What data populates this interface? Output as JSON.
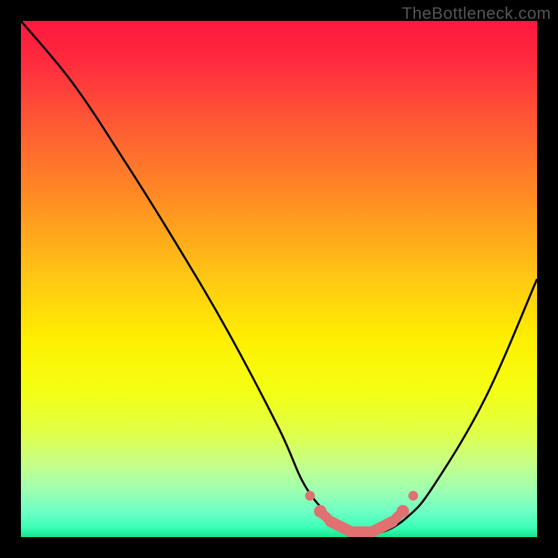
{
  "watermark": "TheBottleneck.com",
  "chart_data": {
    "type": "line",
    "title": "",
    "xlabel": "",
    "ylabel": "",
    "xlim": [
      0,
      100
    ],
    "ylim": [
      0,
      100
    ],
    "series": [
      {
        "name": "bottleneck-curve",
        "color": "#000000",
        "x": [
          0,
          10,
          20,
          30,
          40,
          50,
          55,
          60,
          65,
          70,
          75,
          80,
          90,
          100
        ],
        "y": [
          100,
          88,
          73,
          57,
          40,
          21,
          10,
          4,
          1,
          1,
          4,
          10,
          27,
          50
        ]
      },
      {
        "name": "optimal-zone",
        "color": "#e17070",
        "x": [
          56,
          58,
          60,
          62,
          64,
          66,
          68,
          70,
          72,
          74,
          76
        ],
        "y": [
          8,
          5,
          3,
          2,
          1,
          1,
          1,
          2,
          3,
          5,
          8
        ]
      }
    ],
    "gradient_stops": [
      {
        "pos": 0.0,
        "color": "#ff173e"
      },
      {
        "pos": 0.08,
        "color": "#ff2b3e"
      },
      {
        "pos": 0.2,
        "color": "#ff5a34"
      },
      {
        "pos": 0.35,
        "color": "#ff8f22"
      },
      {
        "pos": 0.5,
        "color": "#ffc813"
      },
      {
        "pos": 0.62,
        "color": "#fff000"
      },
      {
        "pos": 0.72,
        "color": "#f3ff14"
      },
      {
        "pos": 0.8,
        "color": "#e0ff4a"
      },
      {
        "pos": 0.86,
        "color": "#c4ff8a"
      },
      {
        "pos": 0.91,
        "color": "#9dffb1"
      },
      {
        "pos": 0.95,
        "color": "#6effc4"
      },
      {
        "pos": 0.98,
        "color": "#3effb7"
      },
      {
        "pos": 1.0,
        "color": "#14e68f"
      }
    ]
  }
}
